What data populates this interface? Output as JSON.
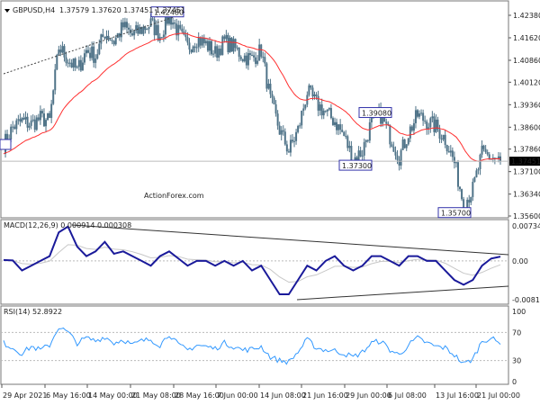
{
  "chart_data": [
    {
      "type": "candlestick",
      "title": "GBPUSD,H4",
      "ohlc_header": "1.37579 1.37620 1.37451 1.37451",
      "ylim": [
        1.356,
        1.4276
      ],
      "yticks": [
        "1.42380",
        "1.41620",
        "1.40860",
        "1.40120",
        "1.39360",
        "1.38600",
        "1.37860",
        "1.37100",
        "1.36340",
        "1.35600"
      ],
      "current_price": "1.37451",
      "annotations": [
        "1.42480",
        "1.39080",
        "1.37300",
        "1.35700"
      ],
      "watermark": "ActionForex.com",
      "close_approx": [
        1.38,
        1.386,
        1.388,
        1.387,
        1.389,
        1.388,
        1.413,
        1.409,
        1.405,
        1.412,
        1.41,
        1.418,
        1.415,
        1.42,
        1.417,
        1.419,
        1.421,
        1.417,
        1.424,
        1.418,
        1.413,
        1.416,
        1.414,
        1.411,
        1.415,
        1.413,
        1.41,
        1.409,
        1.412,
        1.395,
        1.385,
        1.378,
        1.385,
        1.398,
        1.394,
        1.391,
        1.388,
        1.383,
        1.375,
        1.378,
        1.388,
        1.39,
        1.383,
        1.376,
        1.384,
        1.39,
        1.388,
        1.386,
        1.382,
        1.374,
        1.36,
        1.365,
        1.377,
        1.376,
        1.3745
      ],
      "ma_color": "#ff3030",
      "candle_color": "#4f7388"
    },
    {
      "type": "line",
      "title": "MACD(12,26,9) 0.000914 0.000308",
      "yticks": [
        "0.007342",
        "0.00",
        "-0.008126"
      ],
      "ylim": [
        -0.0085,
        0.0075
      ],
      "macd": [
        0.0002,
        0.0001,
        -0.002,
        -0.001,
        0.0,
        0.001,
        0.006,
        0.0072,
        0.003,
        0.001,
        0.002,
        0.004,
        0.0015,
        0.002,
        0.001,
        0.0,
        -0.001,
        0.001,
        0.002,
        0.0005,
        -0.001,
        0.0,
        0.0,
        -0.001,
        0.0,
        -0.001,
        0.0,
        -0.002,
        -0.001,
        -0.004,
        -0.007,
        -0.007,
        -0.004,
        -0.001,
        -0.002,
        0.0,
        0.001,
        -0.001,
        -0.002,
        -0.001,
        0.001,
        0.001,
        0.0,
        -0.001,
        0.001,
        0.001,
        0.0,
        0.0,
        -0.002,
        -0.004,
        -0.005,
        -0.004,
        -0.001,
        0.0005,
        0.0009
      ],
      "signal_color": "#c8c8c8",
      "macd_color": "#1a1a9a"
    },
    {
      "type": "line",
      "title": "RSI(14) 52.8922",
      "yticks": [
        "100",
        "70",
        "30",
        "0"
      ],
      "ylim": [
        0,
        100
      ],
      "levels": [
        70,
        30
      ],
      "values": [
        55,
        48,
        40,
        50,
        45,
        52,
        78,
        70,
        55,
        62,
        58,
        64,
        55,
        60,
        52,
        58,
        60,
        52,
        68,
        52,
        45,
        52,
        50,
        47,
        55,
        50,
        45,
        46,
        50,
        35,
        30,
        28,
        42,
        60,
        48,
        45,
        44,
        40,
        35,
        42,
        55,
        58,
        45,
        38,
        52,
        62,
        55,
        50,
        48,
        38,
        25,
        32,
        58,
        62,
        53
      ],
      "line_color": "#3399ff"
    }
  ],
  "xticks": [
    "29 Apr 2021",
    "6 May 16:00",
    "14 May 00:00",
    "21 May 08:00",
    "28 May 16:00",
    "7 Jun 00:00",
    "14 Jun 08:00",
    "21 Jun 16:00",
    "29 Jun 00:00",
    "6 Jul 08:00",
    "13 Jul 16:00",
    "21 Jul 00:00"
  ]
}
